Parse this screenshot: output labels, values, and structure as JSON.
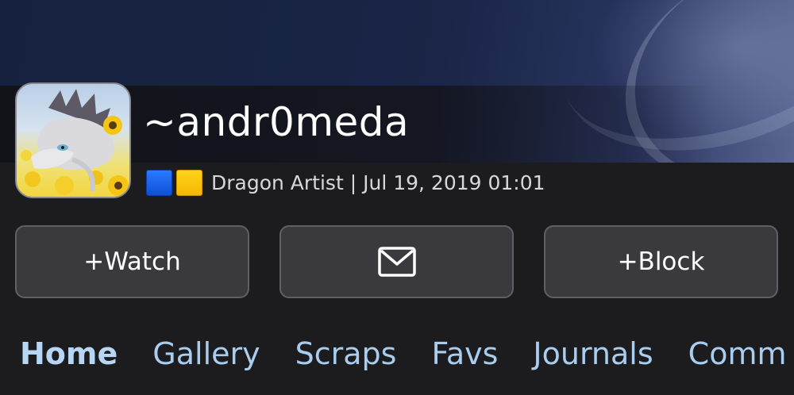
{
  "profile": {
    "username": "~andr0meda",
    "title": "Dragon Artist",
    "separator": "|",
    "joined": "Jul 19, 2019 01:01",
    "badge_colors": [
      "#1f63f0",
      "#ffc812"
    ]
  },
  "actions": {
    "watch_label": "+Watch",
    "message_icon": "envelope-icon",
    "block_label": "+Block"
  },
  "nav": {
    "tabs": [
      {
        "label": "Home",
        "active": true
      },
      {
        "label": "Gallery",
        "active": false
      },
      {
        "label": "Scraps",
        "active": false
      },
      {
        "label": "Favs",
        "active": false
      },
      {
        "label": "Journals",
        "active": false
      },
      {
        "label": "Comm",
        "active": false
      }
    ]
  },
  "colors": {
    "accent_link": "#a9cdef",
    "background": "#1c1c1e",
    "button_bg": "#3a3a3e"
  }
}
